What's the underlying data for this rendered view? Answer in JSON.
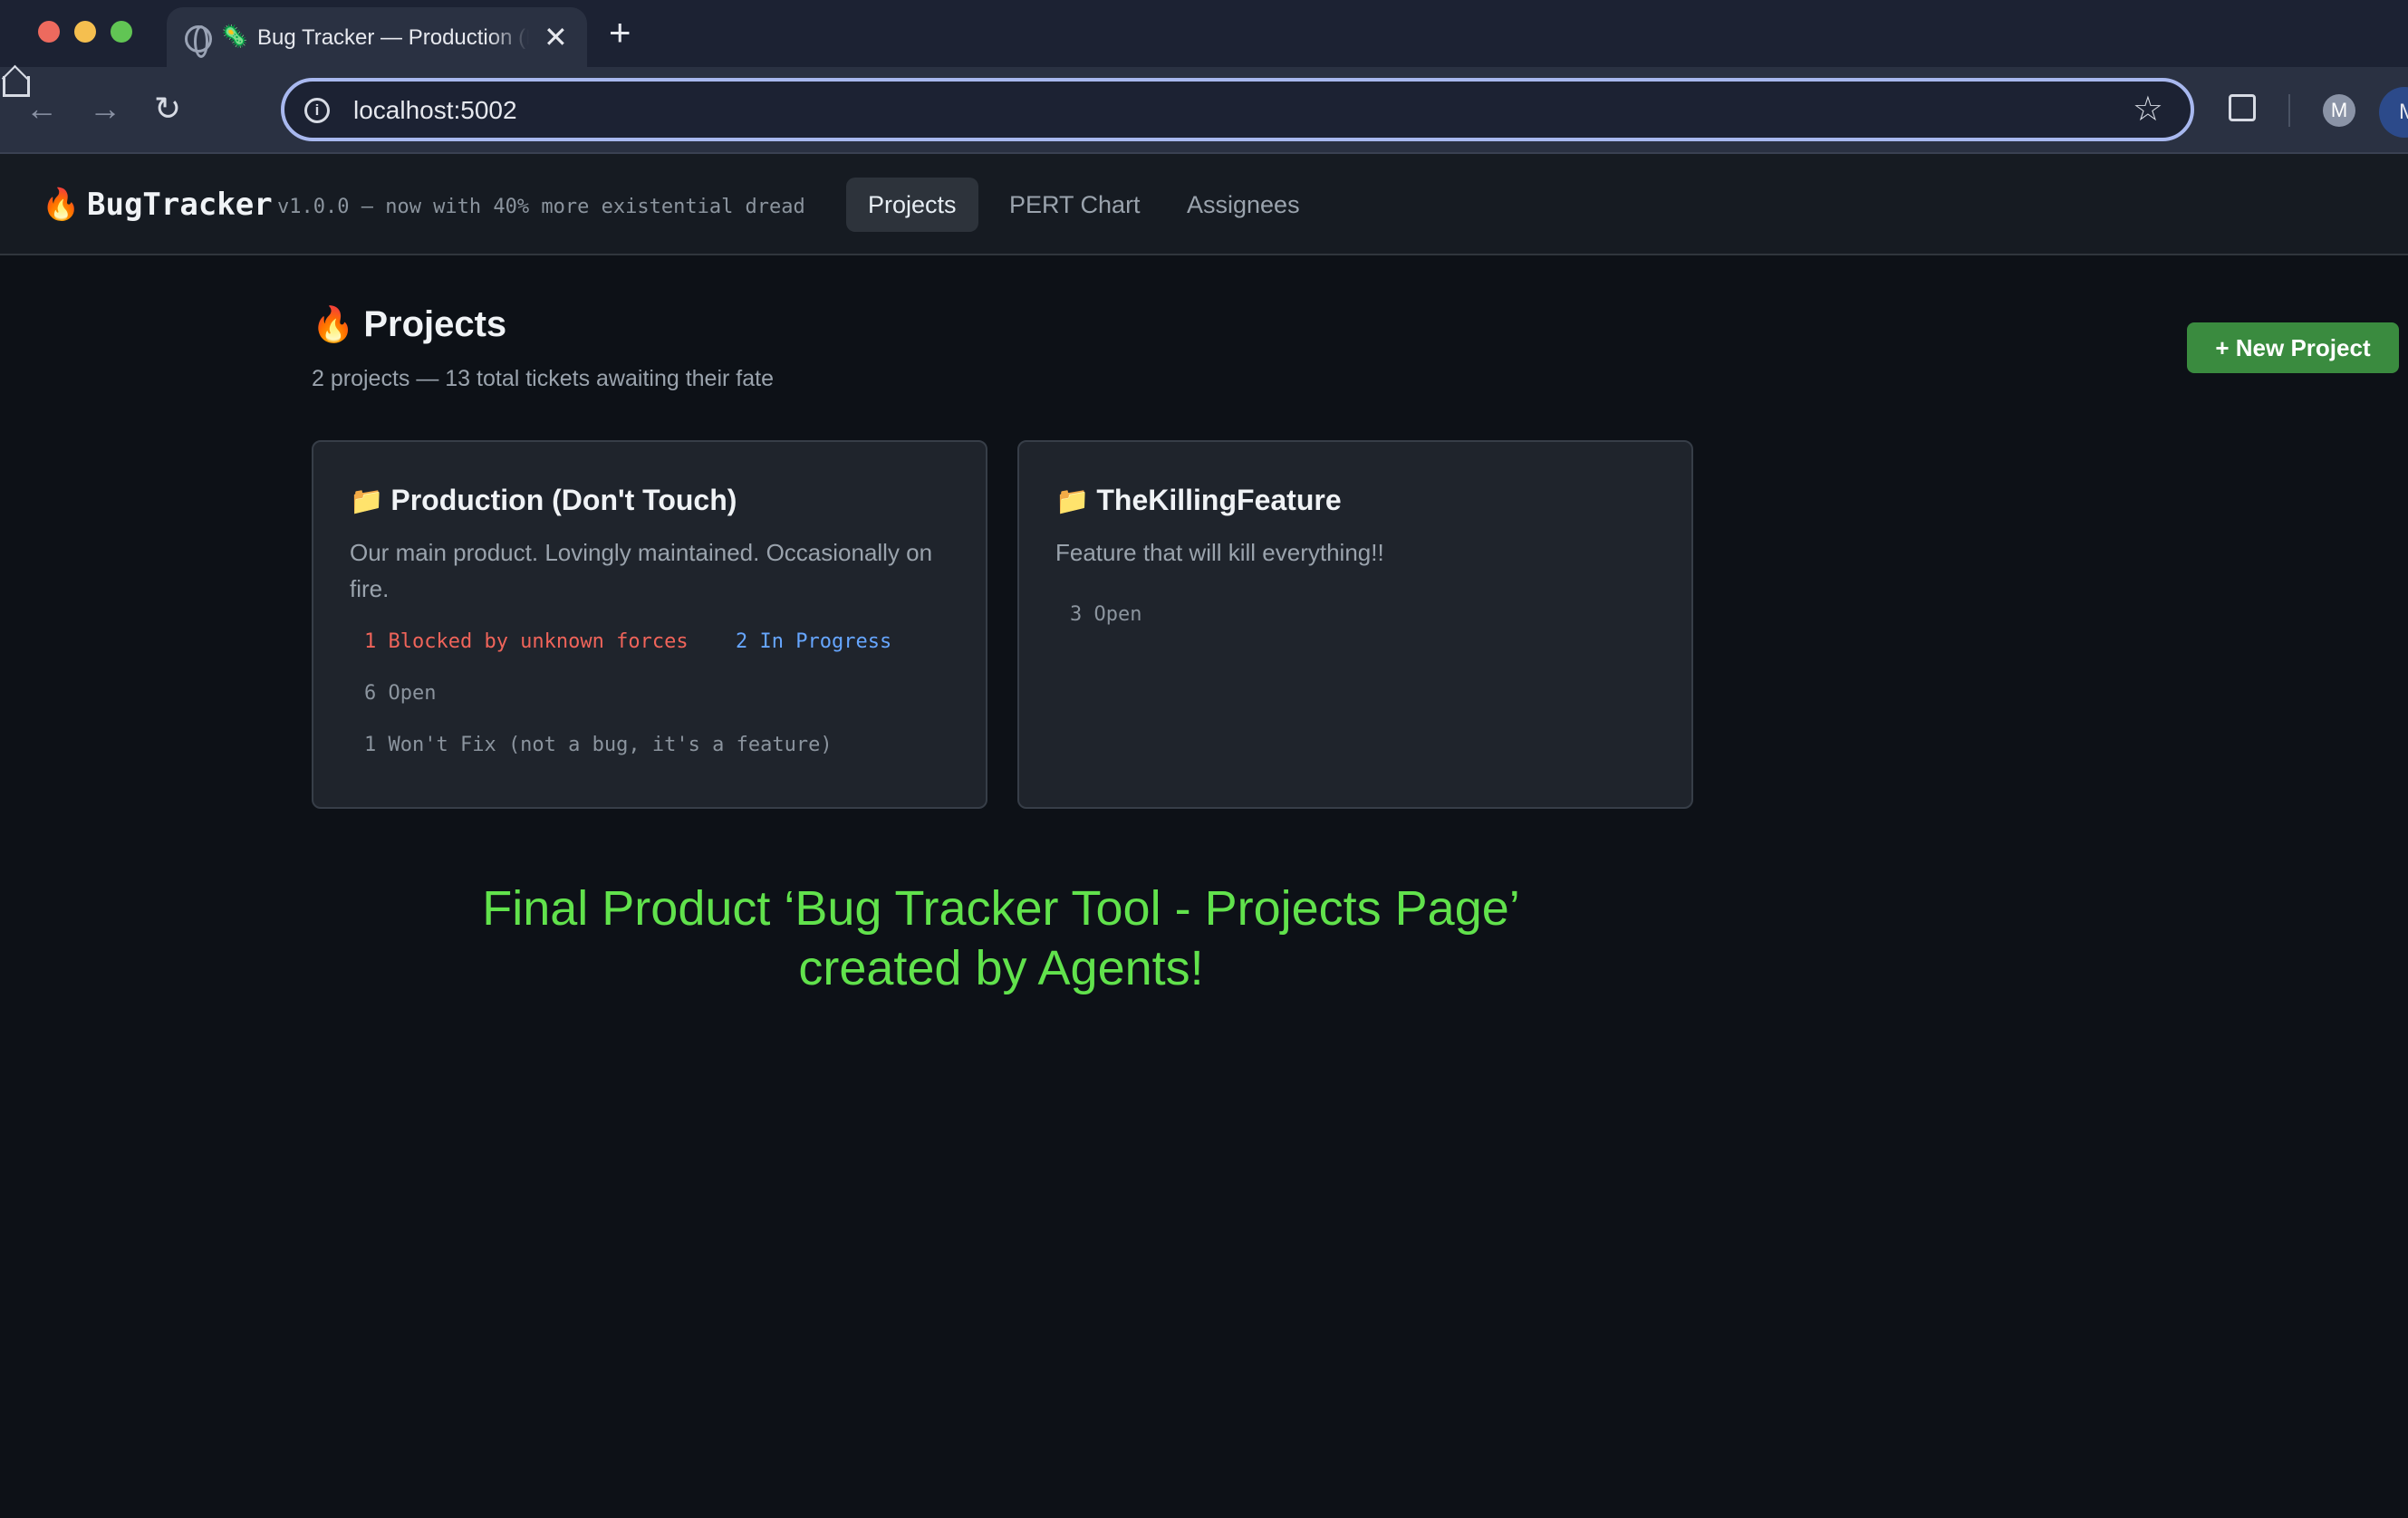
{
  "browser": {
    "tab_title": "Bug Tracker — Production (Don't Touch)",
    "tab_favicon": "🦠",
    "url": "localhost:5002",
    "profile_initial": "M",
    "profile_initial_2": "M"
  },
  "icons": {
    "back": "back-arrow-icon",
    "forward": "forward-arrow-icon",
    "reload": "reload-icon",
    "home": "home-icon",
    "info": "info-icon",
    "star": "star-icon",
    "extensions": "puzzle-icon",
    "fire": "fire-icon",
    "folder": "folder-icon"
  },
  "app": {
    "brand_icon": "🔥",
    "brand_name": "BugTracker",
    "tagline": "v1.0.0 — now with 40% more existential dread",
    "nav": [
      {
        "label": "Projects",
        "active": true
      },
      {
        "label": "PERT Chart",
        "active": false
      },
      {
        "label": "Assignees",
        "active": false
      }
    ]
  },
  "page": {
    "title_icon": "🔥",
    "title": "Projects",
    "subtitle": "2 projects — 13 total tickets awaiting their fate",
    "new_project_label": "+ New Project"
  },
  "projects": [
    {
      "name": "Production (Don't Touch)",
      "description": "Our main product. Lovingly maintained. Occasionally on fire.",
      "stats": [
        "1 Blocked by unknown forces",
        "2 In Progress",
        "6 Open",
        "1 Won't Fix (not a bug, it's a feature)"
      ]
    },
    {
      "name": "TheKillingFeature",
      "description": "Feature that will kill everything!!",
      "stats": [
        "3 Open"
      ]
    }
  ],
  "caption": {
    "line1": "Final Product ‘Bug Tracker Tool - Projects Page’",
    "line2": "created by Agents!"
  },
  "colors": {
    "page_bg": "#0d1117",
    "card_bg": "#1f242c",
    "accent_green": "#3a8b3f",
    "blocked_red": "#f0645a",
    "progress_blue": "#66a6ff",
    "caption_green": "#61e24c",
    "omnibox_border": "#a8b8ef"
  }
}
